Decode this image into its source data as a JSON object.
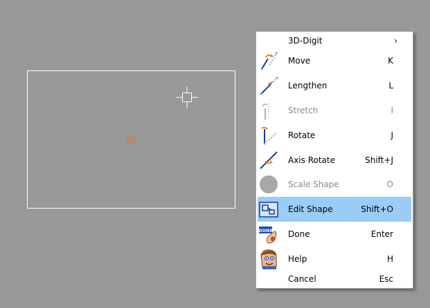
{
  "menu": {
    "items": [
      {
        "label": "3D-Digit",
        "shortcut": "",
        "submenu": true,
        "icon": "none"
      },
      {
        "label": "Move",
        "shortcut": "K",
        "icon": "move-icon"
      },
      {
        "label": "Lengthen",
        "shortcut": "L",
        "icon": "lengthen-icon"
      },
      {
        "label": "Stretch",
        "shortcut": "I",
        "icon": "stretch-icon",
        "disabled": true
      },
      {
        "label": "Rotate",
        "shortcut": "J",
        "icon": "rotate-icon"
      },
      {
        "label": "Axis Rotate",
        "shortcut": "Shift+J",
        "icon": "axis-rotate-icon"
      },
      {
        "label": "Scale Shape",
        "shortcut": "O",
        "icon": "scale-shape-icon",
        "disabled": true
      },
      {
        "label": "Edit Shape",
        "shortcut": "Shift+O",
        "icon": "edit-shape-icon",
        "highlighted": true
      },
      {
        "label": "Done",
        "shortcut": "Enter",
        "icon": "done-icon",
        "icon_text": "DONE"
      },
      {
        "label": "Help",
        "shortcut": "H",
        "icon": "help-face-icon"
      },
      {
        "label": "Cancel",
        "shortcut": "Esc",
        "icon": "none"
      }
    ],
    "submenu_arrow": "›"
  },
  "colors": {
    "background": "#969899",
    "highlight": "#99ccf6",
    "anchor": "#e8742a",
    "disabled_text": "#8a8a8a"
  }
}
